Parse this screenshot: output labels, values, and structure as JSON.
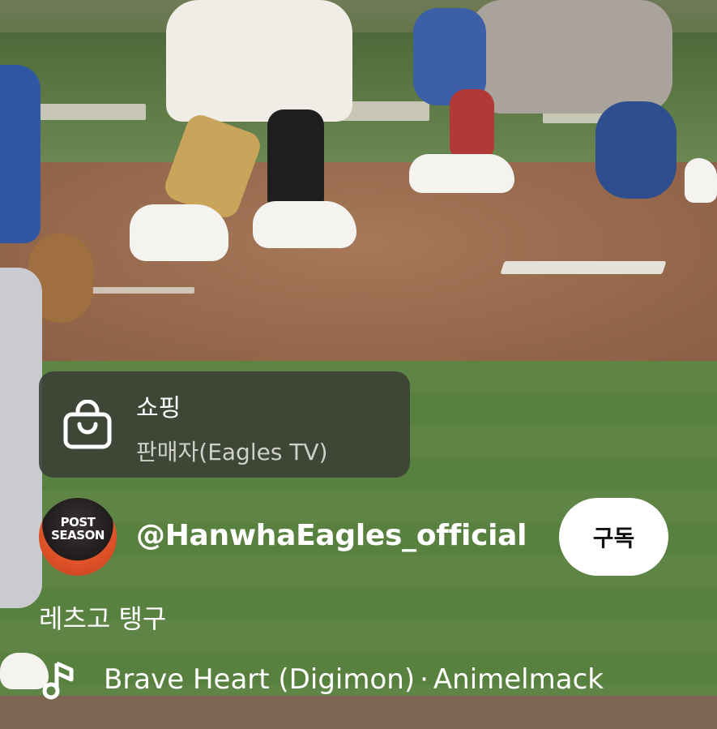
{
  "shopping": {
    "title": "쇼핑",
    "seller": "판매자(Eagles TV)",
    "icon": "shopping-bag-icon"
  },
  "channel": {
    "avatar_text": "POST SEASON",
    "handle": "@HanwhaEagles_official",
    "subscribe_label": "구독"
  },
  "caption": "레츠고 탱구",
  "music": {
    "icon": "music-note-icon",
    "title": "Brave Heart (Digimon)",
    "separator": "·",
    "artist": "Animelmack"
  },
  "colors": {
    "overlay_card": "#3a3e34",
    "text": "#ffffff",
    "subtext": "#cfd0c9",
    "button_bg": "#ffffff"
  }
}
